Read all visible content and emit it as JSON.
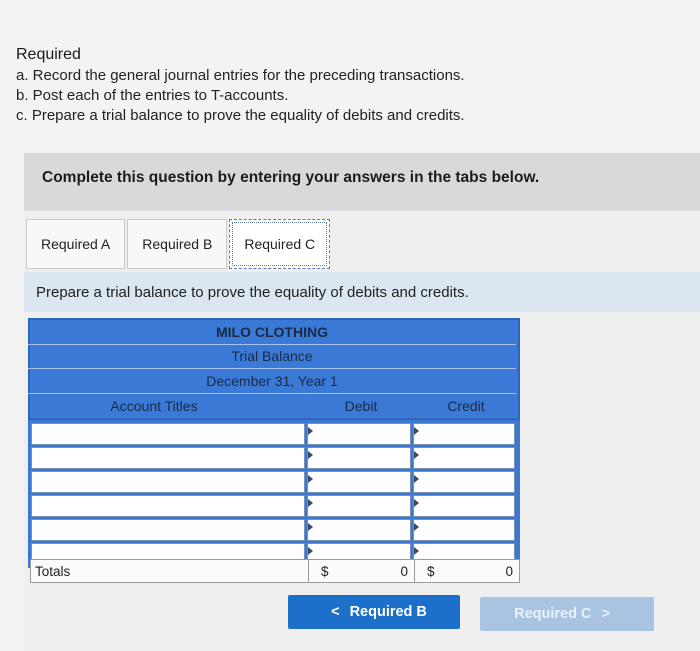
{
  "requirements": {
    "title": "Required",
    "items": [
      "a. Record the general journal entries for the preceding transactions.",
      "b. Post each of the entries to T-accounts.",
      "c. Prepare a trial balance to prove the equality of debits and credits."
    ]
  },
  "banner": {
    "text": "Complete this question by entering your answers in the tabs below."
  },
  "tabs": [
    {
      "label": "Required A"
    },
    {
      "label": "Required B"
    },
    {
      "label": "Required C",
      "active": true
    }
  ],
  "instruction": "Prepare a trial balance to prove the equality of debits and credits.",
  "trial_balance": {
    "company": "MILO CLOTHING",
    "title": "Trial Balance",
    "date": "December 31, Year 1",
    "columns": {
      "account": "Account Titles",
      "debit": "Debit",
      "credit": "Credit"
    },
    "rows": [
      {
        "account": "",
        "debit": "",
        "credit": ""
      },
      {
        "account": "",
        "debit": "",
        "credit": ""
      },
      {
        "account": "",
        "debit": "",
        "credit": ""
      },
      {
        "account": "",
        "debit": "",
        "credit": ""
      },
      {
        "account": "",
        "debit": "",
        "credit": ""
      },
      {
        "account": "",
        "debit": "",
        "credit": ""
      }
    ],
    "totals": {
      "label": "Totals",
      "debit_currency": "$",
      "debit_value": "0",
      "credit_currency": "$",
      "credit_value": "0"
    }
  },
  "nav": {
    "prev_label": "Required B",
    "prev_chevron": "<",
    "next_label": "Required C",
    "next_chevron": ">"
  },
  "colors": {
    "table_header": "#3b79d6",
    "prev_button": "#1d70c9",
    "next_button_disabled": "#a9c3e3"
  }
}
